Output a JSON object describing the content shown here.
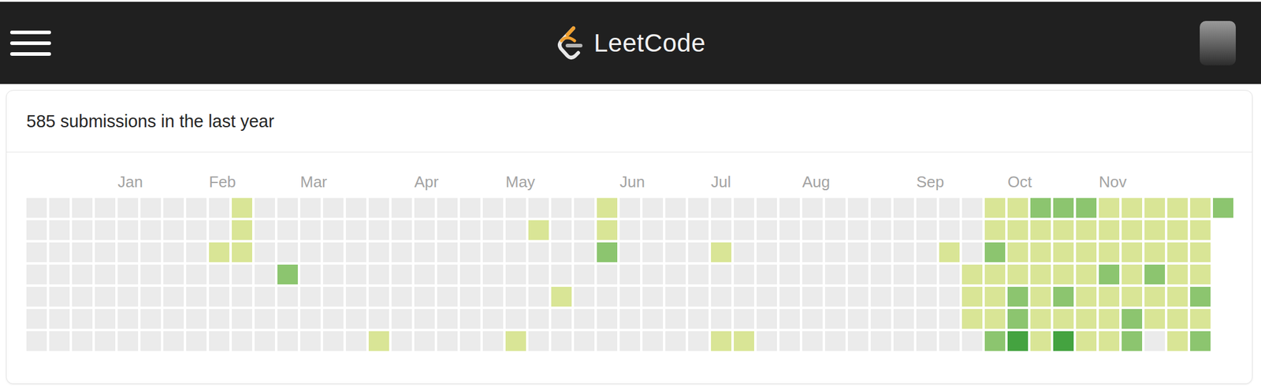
{
  "header": {
    "logo": "LeetCode"
  },
  "card": {
    "title": "585 submissions in the last year"
  },
  "weeks": [
    {
      "days": [
        0,
        0,
        0,
        0,
        0,
        0,
        0
      ]
    },
    {
      "days": [
        0,
        0,
        0,
        0,
        0,
        0,
        0
      ]
    },
    {
      "days": [
        0,
        0,
        0,
        0,
        0,
        0,
        0
      ]
    },
    {
      "days": [
        0,
        0,
        0,
        0,
        0,
        0,
        0
      ]
    },
    {
      "month": "Jan",
      "days": [
        0,
        0,
        0,
        0,
        0,
        0,
        0
      ]
    },
    {
      "days": [
        0,
        0,
        0,
        0,
        0,
        0,
        0
      ]
    },
    {
      "days": [
        0,
        0,
        0,
        0,
        0,
        0,
        0
      ]
    },
    {
      "days": [
        0,
        0,
        0,
        0,
        0,
        0,
        0
      ]
    },
    {
      "month": "Feb",
      "days": [
        0,
        0,
        1,
        0,
        0,
        0,
        0
      ]
    },
    {
      "days": [
        1,
        1,
        1,
        0,
        0,
        0,
        0
      ]
    },
    {
      "days": [
        0,
        0,
        0,
        0,
        0,
        0,
        0
      ]
    },
    {
      "days": [
        0,
        0,
        0,
        2,
        0,
        0,
        0
      ]
    },
    {
      "month": "Mar",
      "days": [
        0,
        0,
        0,
        0,
        0,
        0,
        0
      ]
    },
    {
      "days": [
        0,
        0,
        0,
        0,
        0,
        0,
        0
      ]
    },
    {
      "days": [
        0,
        0,
        0,
        0,
        0,
        0,
        0
      ]
    },
    {
      "days": [
        0,
        0,
        0,
        0,
        0,
        0,
        1
      ]
    },
    {
      "days": [
        0,
        0,
        0,
        0,
        0,
        0,
        0
      ]
    },
    {
      "month": "Apr",
      "days": [
        0,
        0,
        0,
        0,
        0,
        0,
        0
      ]
    },
    {
      "days": [
        0,
        0,
        0,
        0,
        0,
        0,
        0
      ]
    },
    {
      "days": [
        0,
        0,
        0,
        0,
        0,
        0,
        0
      ]
    },
    {
      "days": [
        0,
        0,
        0,
        0,
        0,
        0,
        0
      ]
    },
    {
      "month": "May",
      "days": [
        0,
        0,
        0,
        0,
        0,
        0,
        1
      ]
    },
    {
      "days": [
        0,
        1,
        0,
        0,
        0,
        0,
        0
      ]
    },
    {
      "days": [
        0,
        0,
        0,
        0,
        1,
        0,
        0
      ]
    },
    {
      "days": [
        0,
        0,
        0,
        0,
        0,
        0,
        0
      ]
    },
    {
      "days": [
        1,
        1,
        2,
        0,
        0,
        0,
        0
      ]
    },
    {
      "month": "Jun",
      "days": [
        0,
        0,
        0,
        0,
        0,
        0,
        0
      ]
    },
    {
      "days": [
        0,
        0,
        0,
        0,
        0,
        0,
        0
      ]
    },
    {
      "days": [
        0,
        0,
        0,
        0,
        0,
        0,
        0
      ]
    },
    {
      "days": [
        0,
        0,
        0,
        0,
        0,
        0,
        0
      ]
    },
    {
      "month": "Jul",
      "days": [
        0,
        0,
        1,
        0,
        0,
        0,
        1
      ]
    },
    {
      "days": [
        0,
        0,
        0,
        0,
        0,
        0,
        1
      ]
    },
    {
      "days": [
        0,
        0,
        0,
        0,
        0,
        0,
        0
      ]
    },
    {
      "days": [
        0,
        0,
        0,
        0,
        0,
        0,
        0
      ]
    },
    {
      "month": "Aug",
      "days": [
        0,
        0,
        0,
        0,
        0,
        0,
        0
      ]
    },
    {
      "days": [
        0,
        0,
        0,
        0,
        0,
        0,
        0
      ]
    },
    {
      "days": [
        0,
        0,
        0,
        0,
        0,
        0,
        0
      ]
    },
    {
      "days": [
        0,
        0,
        0,
        0,
        0,
        0,
        0
      ]
    },
    {
      "days": [
        0,
        0,
        0,
        0,
        0,
        0,
        0
      ]
    },
    {
      "month": "Sep",
      "days": [
        0,
        0,
        0,
        0,
        0,
        0,
        0
      ]
    },
    {
      "days": [
        0,
        0,
        1,
        0,
        0,
        0,
        0
      ]
    },
    {
      "days": [
        0,
        0,
        0,
        1,
        1,
        1,
        0
      ]
    },
    {
      "days": [
        1,
        1,
        2,
        1,
        1,
        1,
        2
      ]
    },
    {
      "month": "Oct",
      "days": [
        1,
        1,
        1,
        1,
        2,
        2,
        3
      ]
    },
    {
      "days": [
        2,
        1,
        1,
        1,
        1,
        1,
        1
      ]
    },
    {
      "days": [
        2,
        1,
        1,
        1,
        2,
        1,
        3
      ]
    },
    {
      "days": [
        2,
        1,
        1,
        1,
        1,
        1,
        1
      ]
    },
    {
      "month": "Nov",
      "days": [
        1,
        1,
        1,
        2,
        1,
        1,
        1
      ]
    },
    {
      "days": [
        1,
        1,
        1,
        1,
        1,
        2,
        2
      ]
    },
    {
      "days": [
        1,
        1,
        1,
        2,
        1,
        1,
        0
      ]
    },
    {
      "days": [
        1,
        1,
        1,
        1,
        1,
        1,
        1
      ]
    },
    {
      "days": [
        1,
        1,
        1,
        1,
        2,
        1,
        2
      ]
    },
    {
      "days": [
        2
      ]
    }
  ]
}
